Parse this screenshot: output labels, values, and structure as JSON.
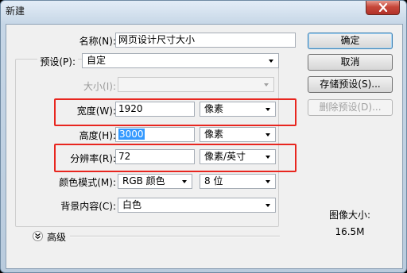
{
  "window": {
    "title": "新建"
  },
  "fields": {
    "name": {
      "label": "名称(N):",
      "value": "网页设计尺寸大小"
    },
    "preset": {
      "label": "预设(P):",
      "value": "自定"
    },
    "size": {
      "label": "大小(I):",
      "value": ""
    },
    "width": {
      "label": "宽度(W):",
      "value": "1920",
      "unit": "像素"
    },
    "height": {
      "label": "高度(H):",
      "value": "3000",
      "unit": "像素"
    },
    "resolution": {
      "label": "分辨率(R):",
      "value": "72",
      "unit": "像素/英寸"
    },
    "color_mode": {
      "label": "颜色模式(M):",
      "value": "RGB 颜色",
      "depth": "8 位"
    },
    "background": {
      "label": "背景内容(C):",
      "value": "白色"
    }
  },
  "advanced": {
    "label": "高级"
  },
  "buttons": {
    "ok": "确定",
    "cancel": "取消",
    "save_preset": "存储预设(S)...",
    "delete_preset": "删除预设(D)..."
  },
  "image_size": {
    "label": "图像大小:",
    "value": "16.5M"
  },
  "colors": {
    "highlight": "#e8261f",
    "selection": "#3399ff"
  },
  "icons": [
    "close-icon",
    "chevron-down-icon",
    "expand-advanced-icon"
  ]
}
